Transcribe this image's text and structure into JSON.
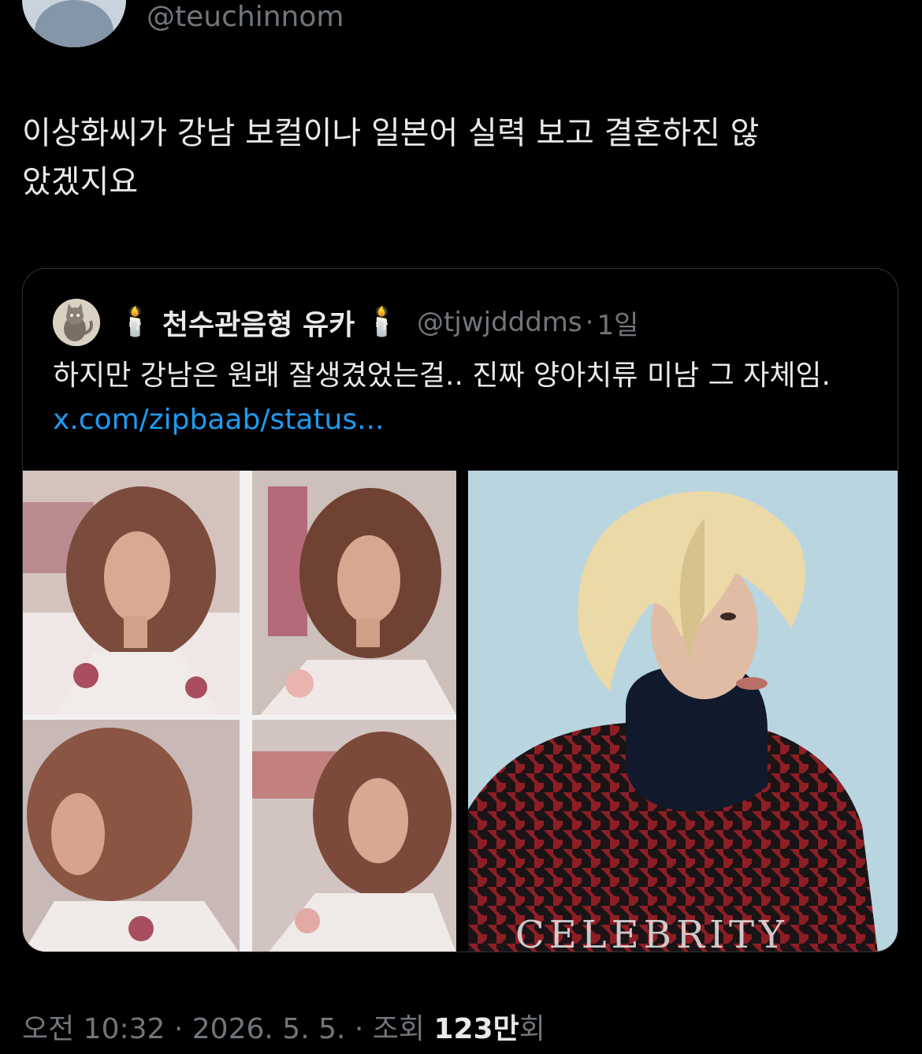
{
  "author": {
    "handle": "@teuchinnom",
    "avatar_icon": "default-avatar-icon"
  },
  "tweet": {
    "text": "이상화씨가 강남 보컬이나 일본어 실력 보고 결혼하진 않\n았겠지요"
  },
  "quoted_tweet": {
    "author_name": "천수관음형 유카",
    "name_prefix_emoji": "🕯️",
    "name_suffix_emoji": "🕯️",
    "handle": "@tjwjdddms",
    "separator": "·",
    "time": "1일",
    "text": "하지만 강남은 원래 잘생겼었는걸..  진짜 양아치류 미남 그 자체임. ",
    "link": "x.com/zipbaab/status...",
    "media": [
      {
        "kind": "photo-collage",
        "description_icon": "photo-collage-icon"
      },
      {
        "kind": "photo",
        "watermark": "CELEBRITY"
      }
    ]
  },
  "meta": {
    "time": "오전 10:32",
    "sep1": " · ",
    "date": "2026. 5. 5.",
    "sep2": " · ",
    "views_label": "조회 ",
    "views_count": "123만",
    "views_suffix": "회"
  },
  "colors": {
    "background": "#000000",
    "text": "#e7e9ea",
    "secondary": "#71767b",
    "link": "#1d9bf0",
    "border": "#2f3336"
  }
}
